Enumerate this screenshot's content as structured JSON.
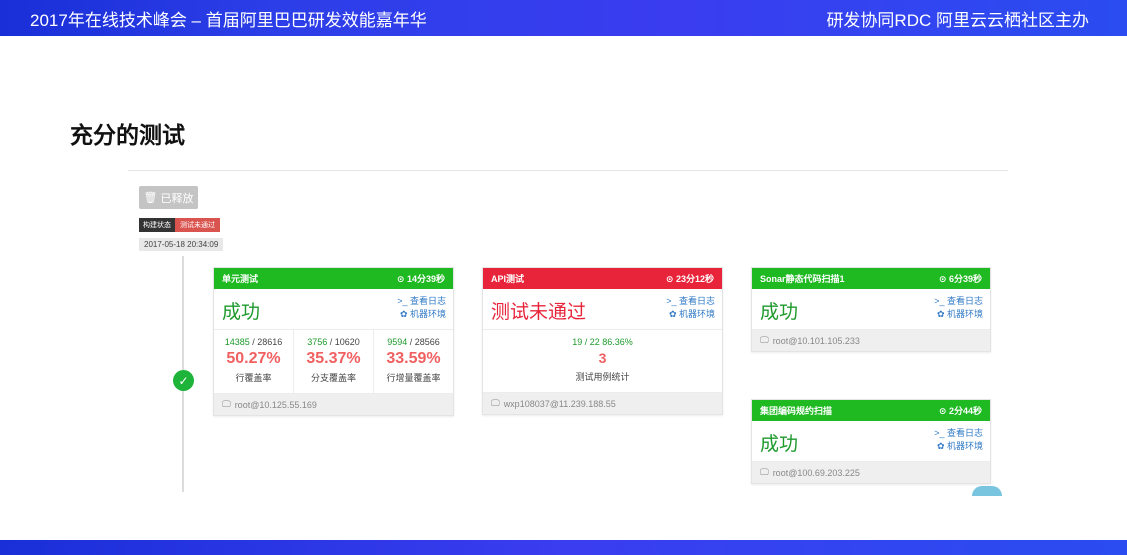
{
  "header": {
    "left": "2017年在线技术峰会 – 首届阿里巴巴研发效能嘉年华",
    "right": "研发协同RDC 阿里云云栖社区主办"
  },
  "title": "充分的测试",
  "release_button": {
    "icon": "trash-icon",
    "label": "已释放"
  },
  "build_status": {
    "key": "构建状态",
    "value": "测试未通过"
  },
  "timestamp": "2017-05-18 20:34:09",
  "common": {
    "view_log": "查看日志",
    "machine_env": "机器环境"
  },
  "cards": {
    "unit": {
      "title": "单元测试",
      "duration": "14分39秒",
      "result": "成功",
      "stats": [
        {
          "num": "14385",
          "den": "28616",
          "pct": "50.27%",
          "label": "行覆盖率"
        },
        {
          "num": "3756",
          "den": "10620",
          "pct": "35.37%",
          "label": "分支覆盖率"
        },
        {
          "num": "9594",
          "den": "28566",
          "pct": "33.59%",
          "label": "行增量覆盖率"
        }
      ],
      "machine": "root@10.125.55.169"
    },
    "api": {
      "title": "API测试",
      "duration": "23分12秒",
      "result": "测试未通过",
      "ratio": "19 / 22 86.36%",
      "failed": "3",
      "stat_label": "测试用例统计",
      "machine": "wxp108037@11.239.188.55"
    },
    "sonar": {
      "title": "Sonar静态代码扫描1",
      "duration": "6分39秒",
      "result": "成功",
      "machine": "root@10.101.105.233"
    },
    "group": {
      "title": "集团编码规约扫描",
      "duration": "2分44秒",
      "result": "成功",
      "machine": "root@100.69.203.225"
    }
  },
  "colors": {
    "success": "#1fb921",
    "failure": "#e8243b",
    "header": "#2c3ee8"
  }
}
